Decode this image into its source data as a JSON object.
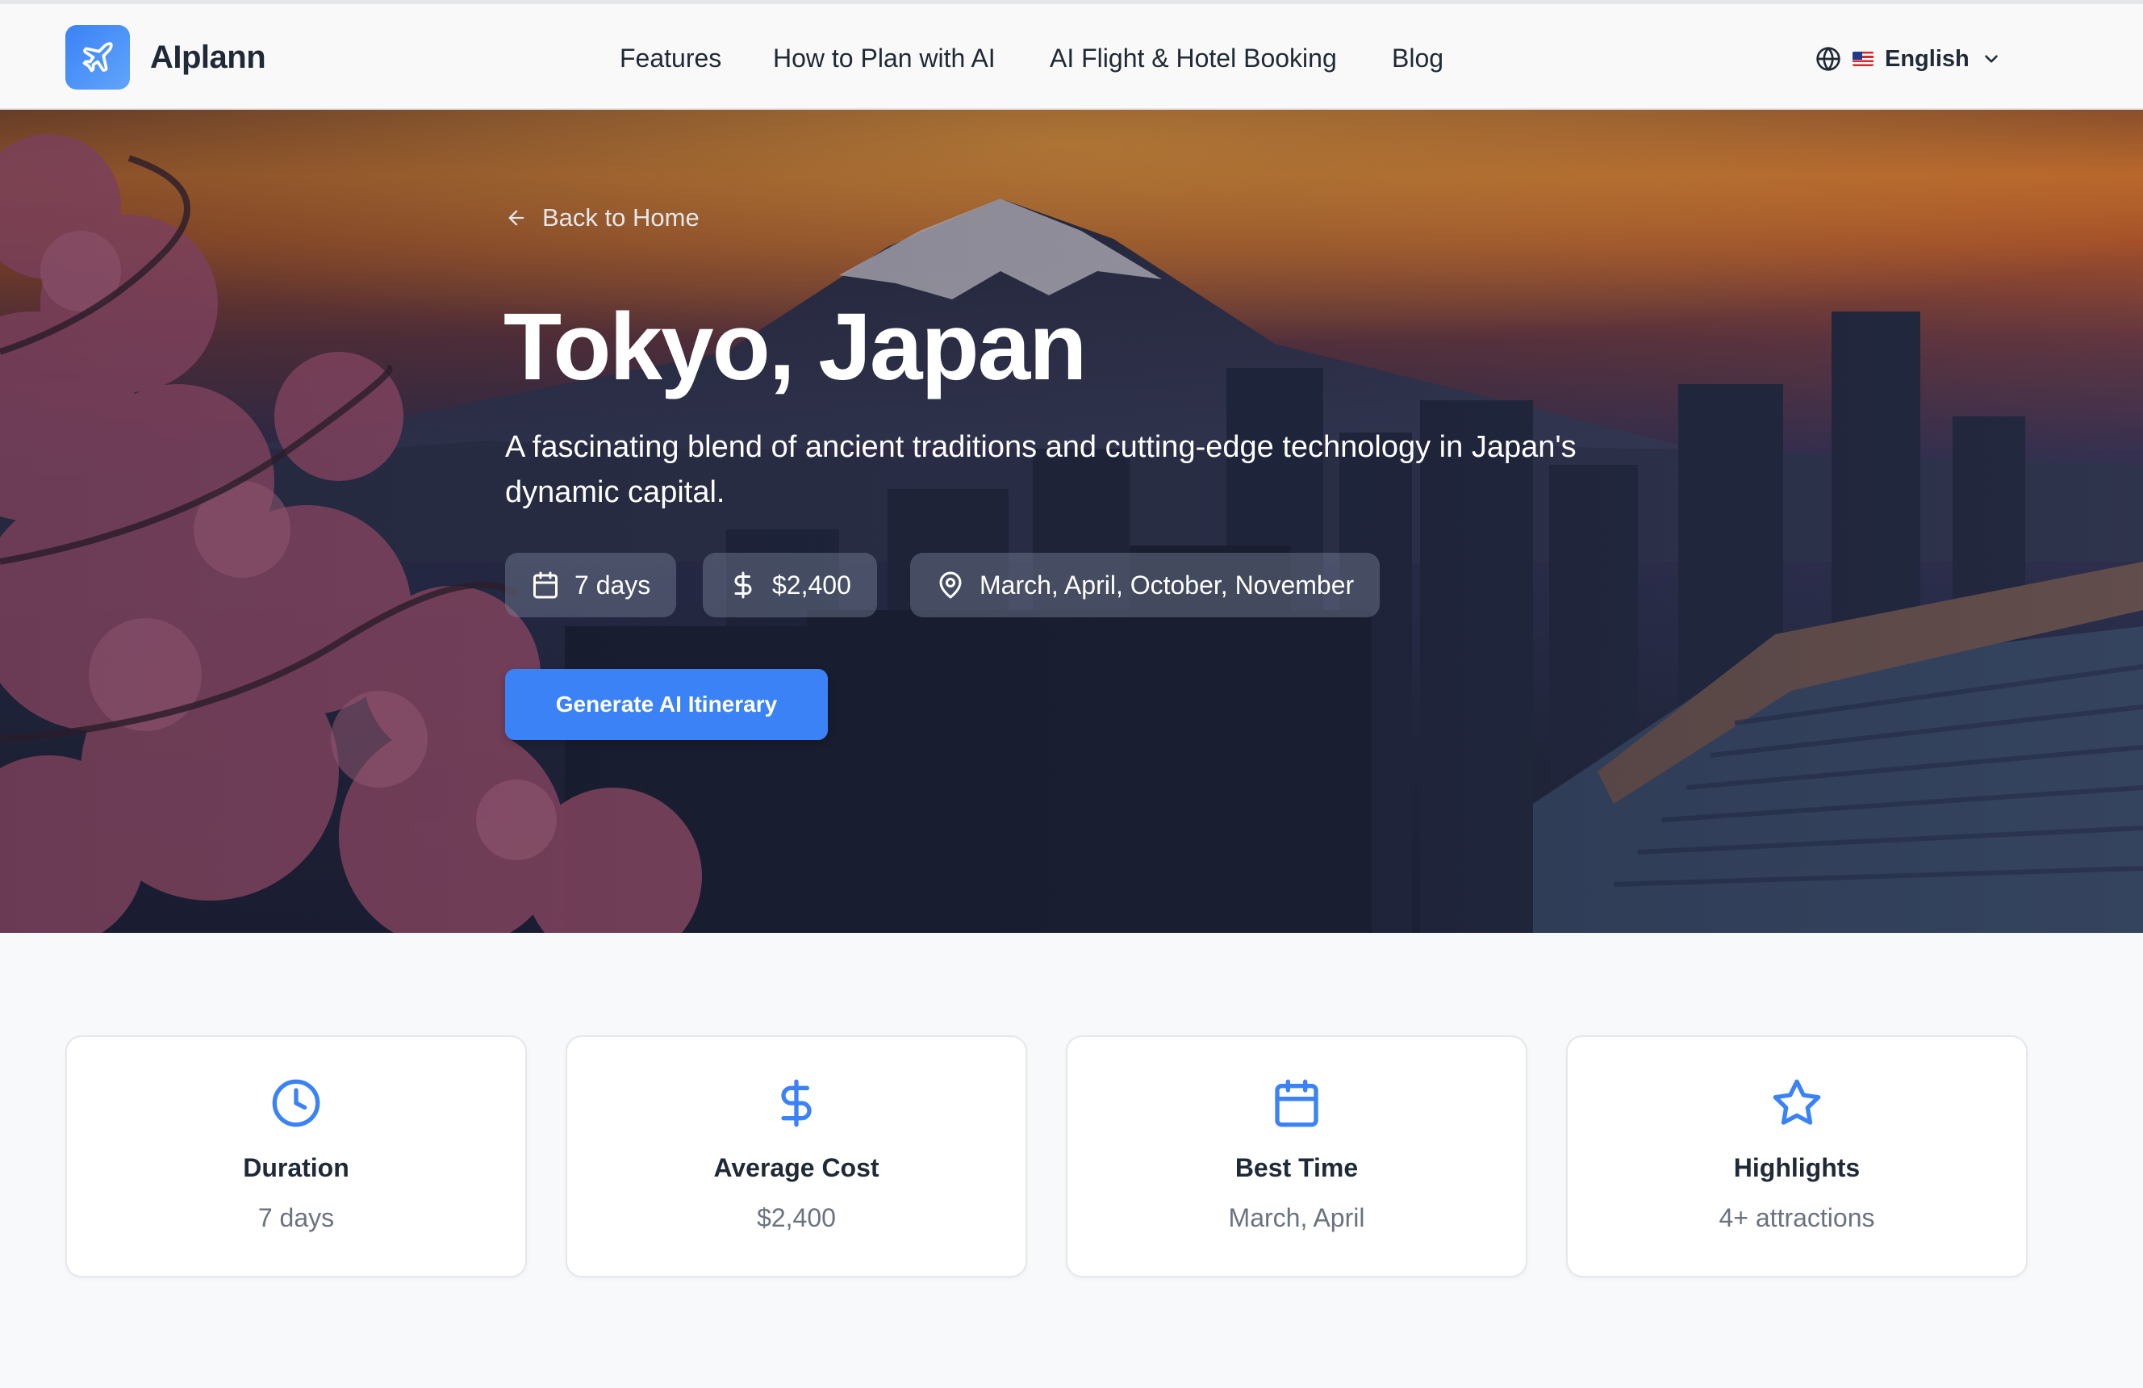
{
  "brand": {
    "name": "AIplann",
    "logo_icon": "plane-icon",
    "logo_color": "#3b82f6"
  },
  "nav": {
    "links": [
      {
        "label": "Features"
      },
      {
        "label": "How to Plan with AI"
      },
      {
        "label": "AI Flight & Hotel Booking"
      },
      {
        "label": "Blog"
      }
    ],
    "language": {
      "label": "English",
      "icon": "globe-icon",
      "flag": "us-flag-icon"
    }
  },
  "hero": {
    "back_label": "Back to Home",
    "title": "Tokyo, Japan",
    "description": "A fascinating blend of ancient traditions and cutting-edge technology in Japan's dynamic capital.",
    "chips": [
      {
        "icon": "calendar-icon",
        "label": "7 days"
      },
      {
        "icon": "dollar-icon",
        "label": "$2,400"
      },
      {
        "icon": "map-pin-icon",
        "label": "March, April, October, November"
      }
    ],
    "cta_label": "Generate AI Itinerary"
  },
  "stats": [
    {
      "icon": "clock-icon",
      "title": "Duration",
      "value": "7 days"
    },
    {
      "icon": "dollar-icon",
      "title": "Average Cost",
      "value": "$2,400"
    },
    {
      "icon": "calendar-icon",
      "title": "Best Time",
      "value": "March, April"
    },
    {
      "icon": "star-icon",
      "title": "Highlights",
      "value": "4+ attractions"
    }
  ],
  "colors": {
    "accent": "#3b82f6",
    "text": "#1f2937",
    "muted": "#6b7280",
    "page_bg": "#f8f9fb"
  }
}
